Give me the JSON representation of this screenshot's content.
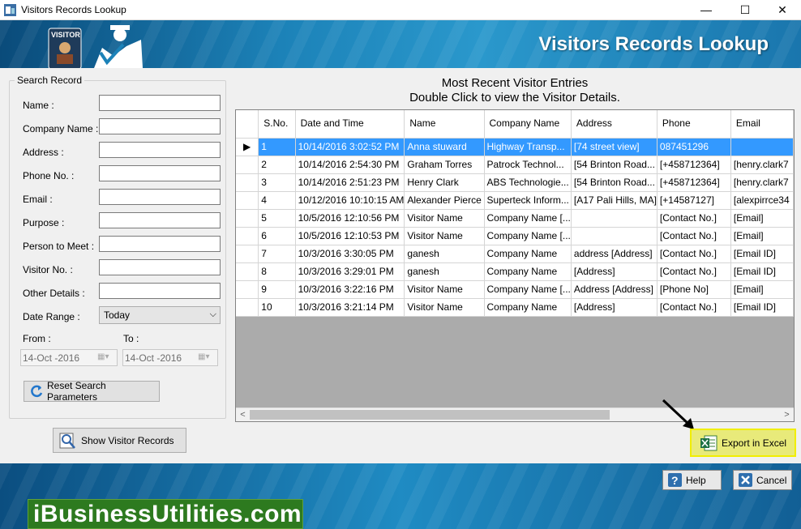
{
  "window": {
    "title": "Visitors Records Lookup",
    "minimize": "—",
    "maximize": "☐",
    "close": "✕"
  },
  "banner": {
    "heading": "Visitors Records Lookup",
    "badge_text": "VISITOR"
  },
  "search": {
    "group_title": "Search Record",
    "fields": [
      {
        "label": "Name :",
        "value": ""
      },
      {
        "label": "Company Name :",
        "value": ""
      },
      {
        "label": "Address :",
        "value": ""
      },
      {
        "label": "Phone No. :",
        "value": ""
      },
      {
        "label": "Email :",
        "value": ""
      },
      {
        "label": "Purpose :",
        "value": ""
      },
      {
        "label": "Person to Meet :",
        "value": ""
      },
      {
        "label": "Visitor No. :",
        "value": ""
      },
      {
        "label": "Other Details :",
        "value": ""
      }
    ],
    "date_range_label": "Date Range :",
    "date_range_value": "Today",
    "from_label": "From :",
    "to_label": "To :",
    "from_value": "14-Oct -2016",
    "to_value": "14-Oct -2016",
    "reset_label": "Reset Search Parameters",
    "show_label": "Show Visitor Records"
  },
  "grid": {
    "title_line1": "Most Recent Visitor Entries",
    "title_line2": "Double Click to view the Visitor Details.",
    "columns": [
      "S.No.",
      "Date and Time",
      "Name",
      "Company Name",
      "Address",
      "Phone",
      "Email"
    ],
    "selected_row": 0,
    "rows": [
      [
        "1",
        "10/14/2016 3:02:52 PM",
        "Anna stuward",
        "Highway Transp...",
        "[74 street view]",
        "087451296",
        ""
      ],
      [
        "2",
        "10/14/2016 2:54:30 PM",
        "Graham Torres",
        "Patrock Technol...",
        "[54 Brinton Road...",
        "[+458712364]",
        "[henry.clark7"
      ],
      [
        "3",
        "10/14/2016 2:51:23 PM",
        "Henry Clark",
        "ABS Technologie...",
        "[54 Brinton Road...",
        "[+458712364]",
        "[henry.clark7"
      ],
      [
        "4",
        "10/12/2016 10:10:15 AM",
        "Alexander Pierce",
        "Superteck Inform...",
        "[A17 Pali Hills, MA]",
        "[+14587127]",
        "[alexpirrce34"
      ],
      [
        "5",
        "10/5/2016 12:10:56 PM",
        "Visitor Name",
        "Company Name [...",
        "",
        "[Contact No.]",
        "[Email]"
      ],
      [
        "6",
        "10/5/2016 12:10:53 PM",
        "Visitor Name",
        "Company Name [...",
        "",
        "[Contact No.]",
        "[Email]"
      ],
      [
        "7",
        "10/3/2016 3:30:05 PM",
        "ganesh",
        "Company Name",
        "address [Address]",
        "[Contact No.]",
        "[Email ID]"
      ],
      [
        "8",
        "10/3/2016 3:29:01 PM",
        "ganesh",
        "Company Name",
        " [Address]",
        "[Contact No.]",
        "[Email ID]"
      ],
      [
        "9",
        "10/3/2016 3:22:16 PM",
        "Visitor Name",
        "Company Name [...",
        "Address [Address]",
        "[Phone No]",
        "[Email]"
      ],
      [
        "10",
        "10/3/2016 3:21:14 PM",
        "Visitor Name",
        "Company Name",
        " [Address]",
        "[Contact No.]",
        "[Email ID]"
      ]
    ]
  },
  "export_label": "Export in Excel",
  "footer": {
    "help_label": "Help",
    "cancel_label": "Cancel",
    "brand": "iBusinessUtilities.com"
  },
  "colors": {
    "selection": "#3399ff",
    "export_highlight": "#f1ee00",
    "brand_green": "#2d7a1f"
  }
}
